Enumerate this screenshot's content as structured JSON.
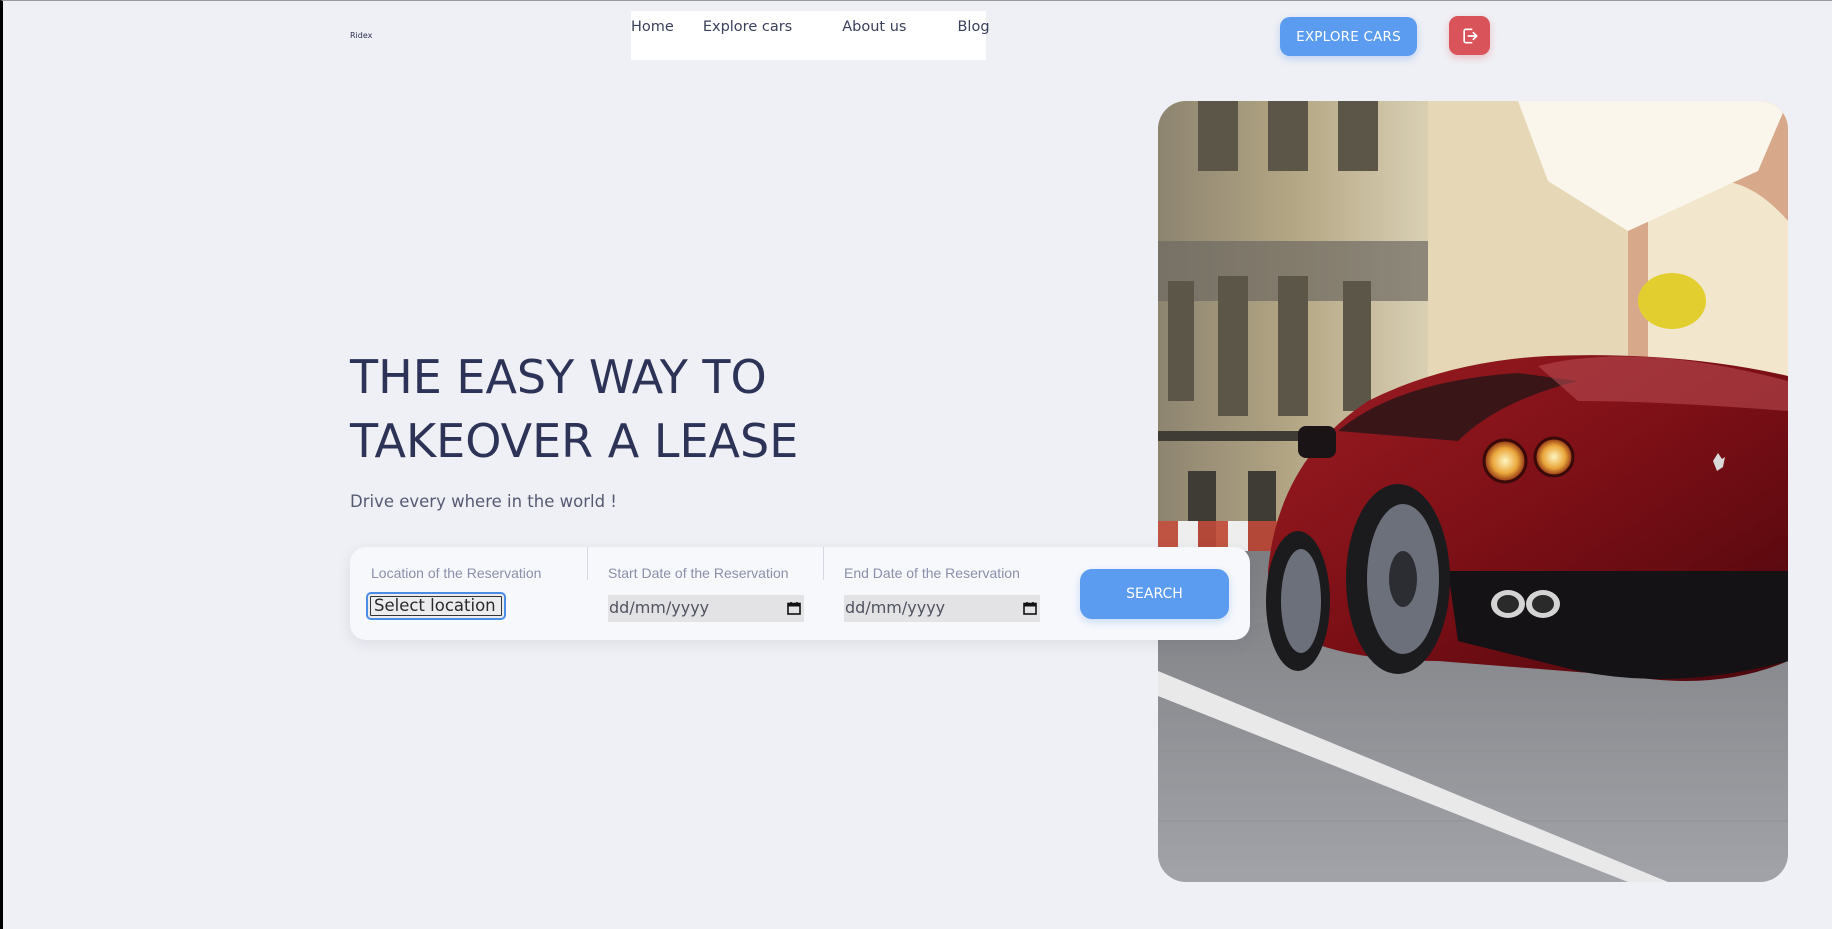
{
  "header": {
    "logo_text": "Ridex",
    "nav": [
      {
        "label": "Home"
      },
      {
        "label": "Explore cars"
      },
      {
        "label": "About us"
      },
      {
        "label": "Blog"
      }
    ],
    "cta_label": "EXPLORE CARS",
    "logout_icon": "logout-icon"
  },
  "hero": {
    "title_line1": "THE EASY WAY TO",
    "title_line2": "TAKEOVER A LEASE",
    "subtitle": "Drive every where in the world !"
  },
  "search": {
    "location_label": "Location of the Reservation",
    "location_value": "Select location",
    "start_label": "Start Date of the Reservation",
    "start_placeholder": "dd/mm/yyyy",
    "end_label": "End Date of the Reservation",
    "end_placeholder": "dd/mm/yyyy",
    "button_label": "SEARCH"
  },
  "colors": {
    "background": "#eff0f5",
    "accent": "#5b9bf0",
    "logout": "#d9535a",
    "heading": "#2c3356"
  },
  "image": {
    "subject": "red sports car on cobblestone street"
  }
}
